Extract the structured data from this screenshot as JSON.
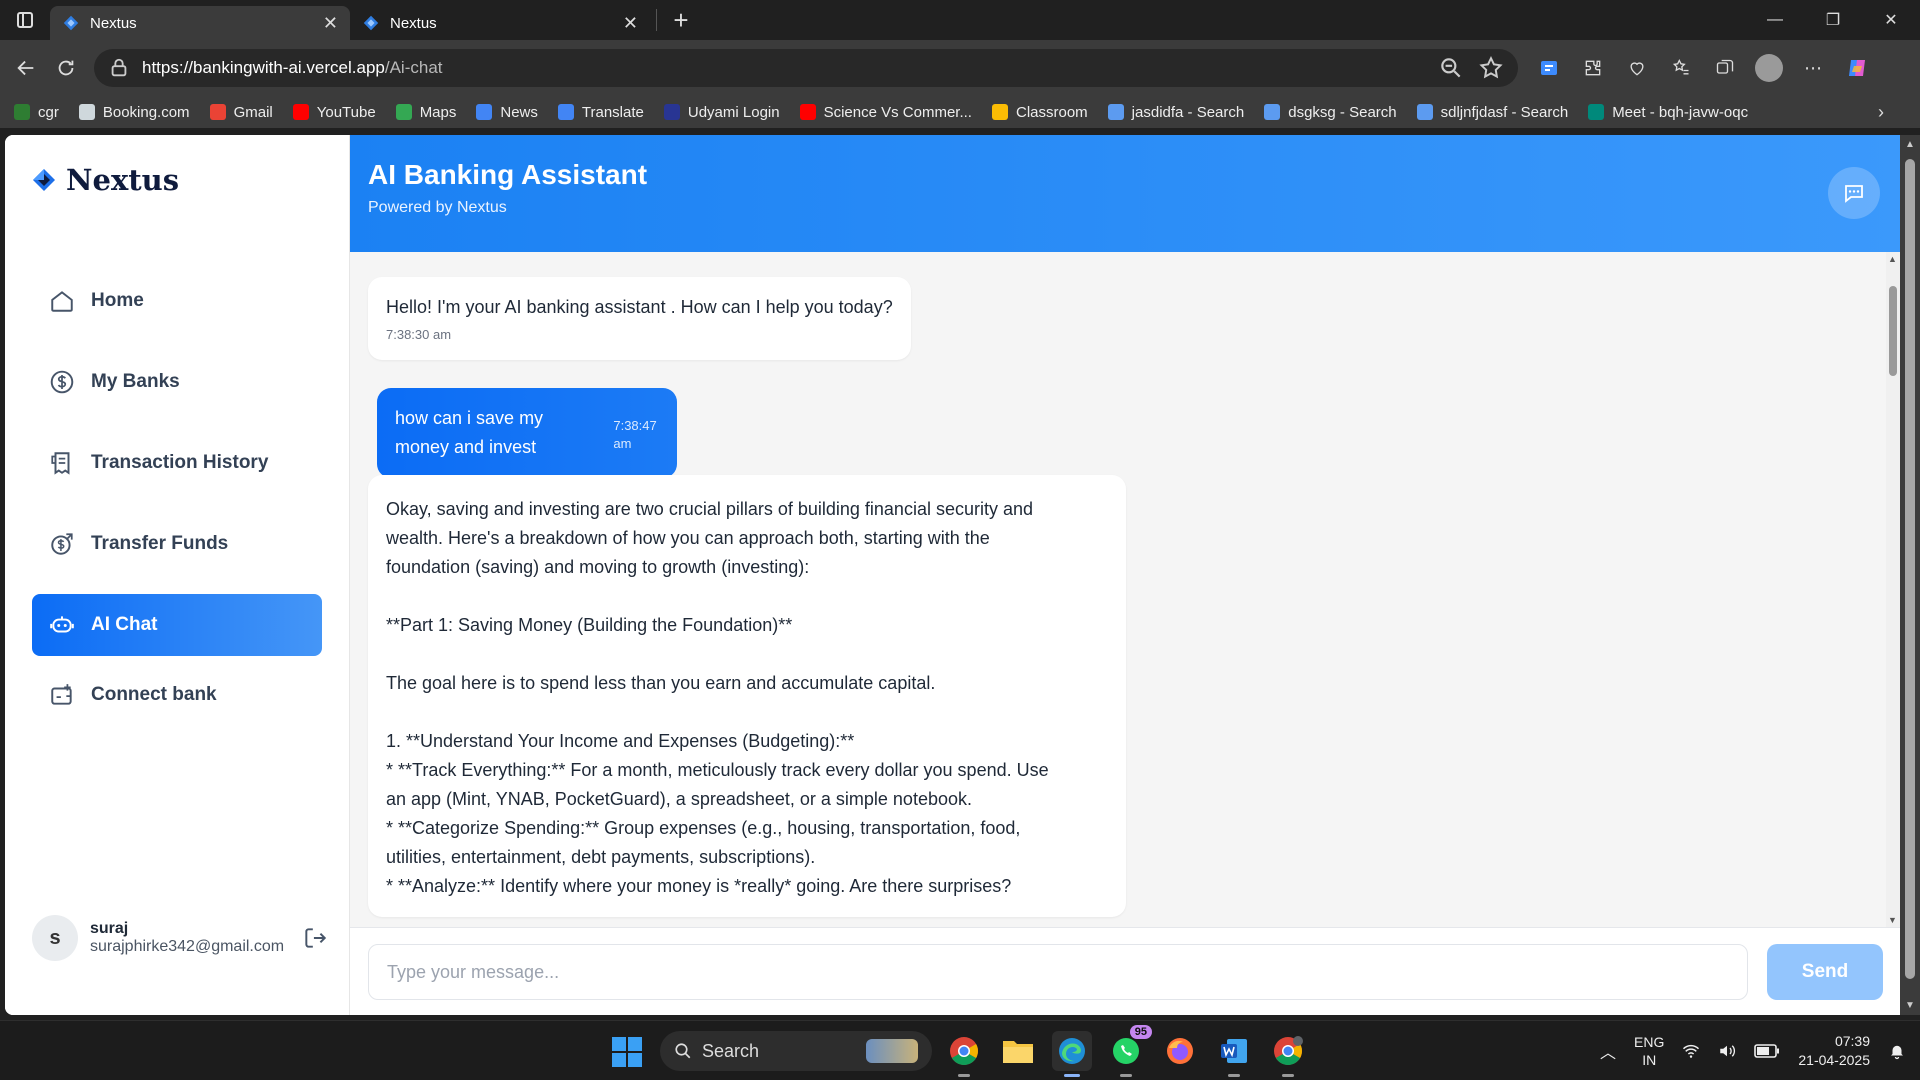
{
  "browser": {
    "tabs": [
      {
        "title": "Nextus",
        "active": true
      },
      {
        "title": "Nextus",
        "active": false
      }
    ],
    "address": {
      "host": "https://bankingwith-ai.vercel.app",
      "path": "/Ai-chat"
    },
    "bookmarks": [
      {
        "label": "cgr",
        "color": "#2e7d32"
      },
      {
        "label": "Booking.com",
        "color": "#cfd8dc"
      },
      {
        "label": "Gmail",
        "color": "#ea4335"
      },
      {
        "label": "YouTube",
        "color": "#ff0000"
      },
      {
        "label": "Maps",
        "color": "#34a853"
      },
      {
        "label": "News",
        "color": "#4285f4"
      },
      {
        "label": "Translate",
        "color": "#4285f4"
      },
      {
        "label": "Udyami Login",
        "color": "#283593"
      },
      {
        "label": "Science Vs Commer...",
        "color": "#ff0000"
      },
      {
        "label": "Classroom",
        "color": "#fbbc04"
      },
      {
        "label": "jasdidfa - Search",
        "color": "#5c9bf0"
      },
      {
        "label": "dsgksg - Search",
        "color": "#5c9bf0"
      },
      {
        "label": "sdljnfjdasf - Search",
        "color": "#5c9bf0"
      },
      {
        "label": "Meet - bqh-javw-oqc",
        "color": "#00897b"
      }
    ]
  },
  "app": {
    "brand": "Nextus",
    "nav": [
      {
        "label": "Home",
        "icon": "home-icon",
        "active": false
      },
      {
        "label": "My Banks",
        "icon": "dollar-circle-icon",
        "active": false
      },
      {
        "label": "Transaction History",
        "icon": "receipt-icon",
        "active": false
      },
      {
        "label": "Transfer Funds",
        "icon": "money-send-icon",
        "active": false
      },
      {
        "label": "AI Chat",
        "icon": "robot-icon",
        "active": true
      },
      {
        "label": "Connect bank",
        "icon": "wallet-plus-icon",
        "active": false
      }
    ],
    "user": {
      "initial": "s",
      "name": "suraj",
      "email": "surajphirke342@gmail.com"
    },
    "accent": "#0b6cf5"
  },
  "chat": {
    "title": "AI Banking Assistant",
    "subtitle": "Powered by Nextus",
    "messages": [
      {
        "role": "ai",
        "text": "Hello! I'm your AI banking assistant . How can I help you today?",
        "time": "7:38:30 am"
      },
      {
        "role": "user",
        "text": "how can i save my money and invest",
        "time": "7:38:47 am"
      },
      {
        "role": "ai",
        "lines": [
          "Okay, saving and investing are two crucial pillars of building financial security and",
          "wealth. Here's a breakdown of how you can approach both, starting with the",
          "foundation (saving) and moving to growth (investing):",
          "",
          "**Part 1: Saving Money (Building the Foundation)**",
          "",
          "The goal here is to spend less than you earn and accumulate capital.",
          "",
          "1. **Understand Your Income and Expenses (Budgeting):**",
          "* **Track Everything:** For a month, meticulously track every dollar you spend. Use",
          "an app (Mint, YNAB, PocketGuard), a spreadsheet, or a simple notebook.",
          "* **Categorize Spending:** Group expenses (e.g., housing, transportation, food,",
          "utilities, entertainment, debt payments, subscriptions).",
          "* **Analyze:** Identify where your money is *really* going. Are there surprises?"
        ]
      }
    ],
    "input_placeholder": "Type your message...",
    "send_label": "Send"
  },
  "taskbar": {
    "search_label": "Search",
    "whatsapp_badge": "95",
    "lang_top": "ENG",
    "lang_bottom": "IN",
    "time": "07:39",
    "date": "21-04-2025"
  }
}
